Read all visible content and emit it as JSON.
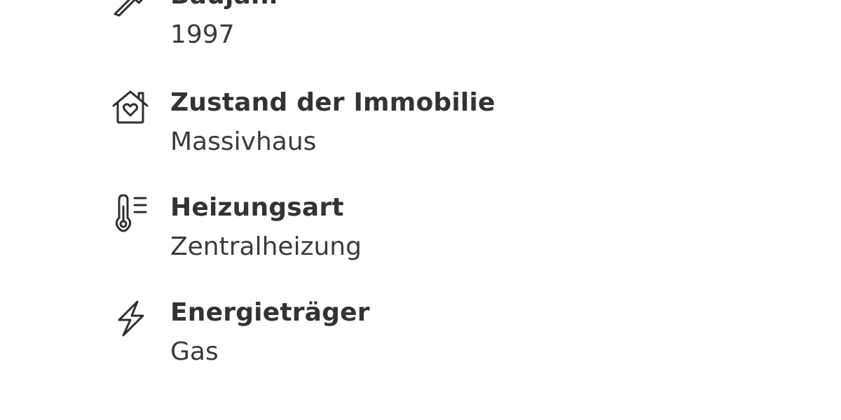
{
  "attributes": [
    {
      "icon": "hammer-icon",
      "label": "Baujahr",
      "value": "1997"
    },
    {
      "icon": "house-heart-icon",
      "label": "Zustand der Immobilie",
      "value": "Massivhaus"
    },
    {
      "icon": "thermometer-icon",
      "label": "Heizungsart",
      "value": "Zentralheizung"
    },
    {
      "icon": "lightning-bolt-icon",
      "label": "Energieträger",
      "value": "Gas"
    }
  ]
}
